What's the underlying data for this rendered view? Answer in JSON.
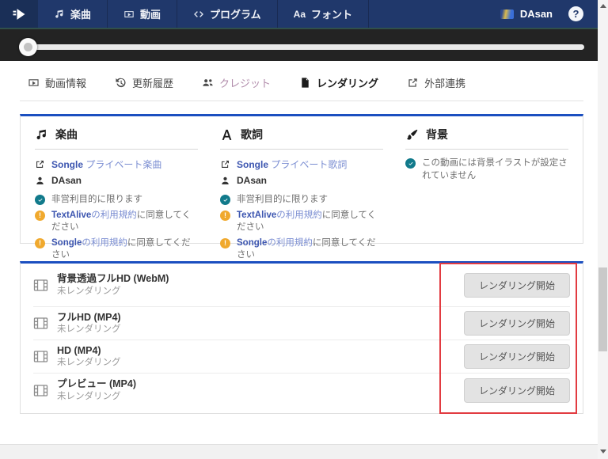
{
  "nav": {
    "items": [
      {
        "label": "楽曲"
      },
      {
        "label": "動画"
      },
      {
        "label": "プログラム"
      },
      {
        "label": "フォント"
      }
    ],
    "font_icon_text": "Aa",
    "user_name": "DAsan",
    "help_label": "?"
  },
  "player": {
    "progress_percent": 0
  },
  "tabs": [
    {
      "label": "動画情報"
    },
    {
      "label": "更新履歴"
    },
    {
      "label": "クレジット"
    },
    {
      "label": "レンダリング"
    },
    {
      "label": "外部連携"
    }
  ],
  "info_card": {
    "music": {
      "title": "楽曲",
      "link_bold": "Songle",
      "link_light": "プライベート楽曲",
      "author": "DAsan",
      "note_ok": "非営利目的に限ります",
      "warn1": {
        "link_bold": "TextAlive",
        "link_light": "の利用規約",
        "rest": "に同意してください"
      },
      "warn2": {
        "link_bold": "Songle",
        "link_light": "の利用規約",
        "rest": "に同意してください"
      }
    },
    "lyrics": {
      "title": "歌詞",
      "link_bold": "Songle",
      "link_light": "プライベート歌詞",
      "author": "DAsan",
      "note_ok": "非営利目的に限ります",
      "warn1": {
        "link_bold": "TextAlive",
        "link_light": "の利用規約",
        "rest": "に同意してください"
      },
      "warn2": {
        "link_bold": "Songle",
        "link_light": "の利用規約",
        "rest": "に同意してください"
      }
    },
    "background": {
      "title": "背景",
      "note_ok": "この動画には背景イラストが設定されていません"
    }
  },
  "render_card": {
    "rows": [
      {
        "title": "背景透過フルHD (WebM)",
        "status": "未レンダリング",
        "button": "レンダリング開始"
      },
      {
        "title": "フルHD (MP4)",
        "status": "未レンダリング",
        "button": "レンダリング開始"
      },
      {
        "title": "HD (MP4)",
        "status": "未レンダリング",
        "button": "レンダリング開始"
      },
      {
        "title": "プレビュー (MP4)",
        "status": "未レンダリング",
        "button": "レンダリング開始"
      }
    ]
  },
  "colors": {
    "navbar": "#20386b",
    "accent_blue_border": "#1b4fc0",
    "link_bold": "#3d56b0",
    "link_light": "#7b8ed2",
    "ok_teal": "#117a8b",
    "warn_amber": "#f0a92e",
    "annotation_red": "#e23b41"
  }
}
